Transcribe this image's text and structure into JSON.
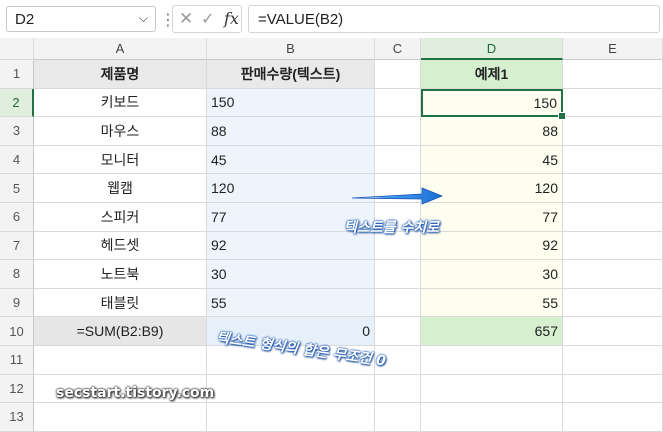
{
  "formula_bar": {
    "name_box": "D2",
    "formula": "=VALUE(B2)",
    "cancel_icon": "close-icon",
    "enter_icon": "check-icon",
    "function_label": "fx"
  },
  "columns": [
    "A",
    "B",
    "C",
    "D",
    "E"
  ],
  "rows": [
    "1",
    "2",
    "3",
    "4",
    "5",
    "6",
    "7",
    "8",
    "9",
    "10",
    "11",
    "12",
    "13"
  ],
  "table": {
    "header_a": "제품명",
    "header_b": "판매수량(텍스트)",
    "header_d": "예제1",
    "products": [
      "키보드",
      "마우스",
      "모니터",
      "웹캠",
      "스피커",
      "헤드셋",
      "노트북",
      "태블릿"
    ],
    "text_qty": [
      "150",
      "88",
      "45",
      "120",
      "77",
      "92",
      "30",
      "55"
    ],
    "values": [
      "150",
      "88",
      "45",
      "120",
      "77",
      "92",
      "30",
      "55"
    ],
    "sum_label": "=SUM(B2:B9)",
    "sum_text": "0",
    "sum_value": "657"
  },
  "annotations": {
    "arrow_note": "텍스트를 수치로",
    "sum_note": "텍스트 형식의 합은 무조건 0",
    "watermark": "secstart.tistory.com"
  },
  "colors": {
    "accent": "#217346",
    "annotation": "#1756b5"
  }
}
